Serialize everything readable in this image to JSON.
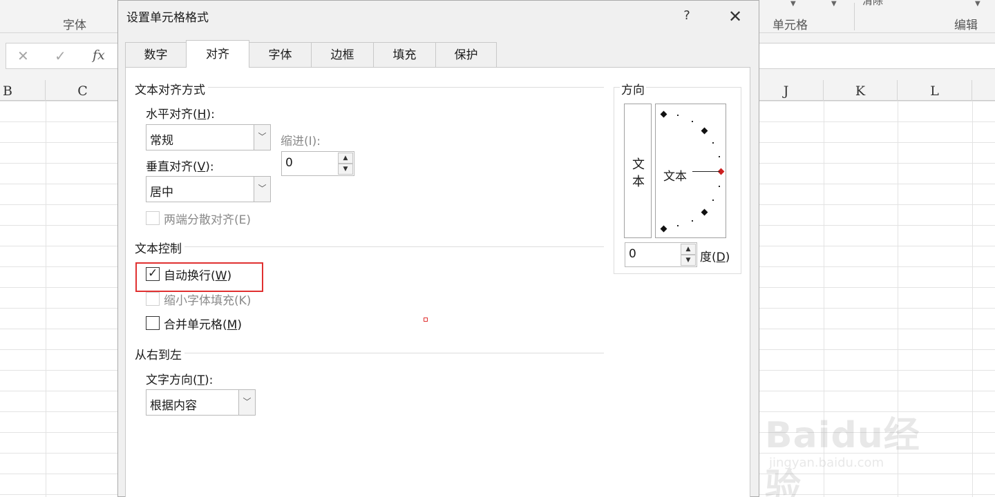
{
  "ribbon": {
    "groups": [
      "字体",
      "单元格",
      "编辑"
    ],
    "clear_partial": "清除"
  },
  "formula_bar": {
    "cancel_icon": "✕",
    "enter_icon": "✓",
    "fx_label": "fx"
  },
  "columns": [
    "B",
    "C",
    "J",
    "K",
    "L"
  ],
  "dialog": {
    "title": "设置单元格格式",
    "help": "?",
    "close": "✕",
    "tabs": [
      "数字",
      "对齐",
      "字体",
      "边框",
      "填充",
      "保护"
    ],
    "active_tab": "对齐",
    "text_alignment": {
      "title": "文本对齐方式",
      "horizontal_label": "水平对齐(H):",
      "horizontal_label_pre": "水平对齐(",
      "horizontal_label_key": "H",
      "horizontal_label_post": "):",
      "horizontal_value": "常规",
      "indent_label": "缩进(I):",
      "indent_value": "0",
      "vertical_label_pre": "垂直对齐(",
      "vertical_label_key": "V",
      "vertical_label_post": "):",
      "vertical_value": "居中",
      "justify_distributed": "两端分散对齐(E)"
    },
    "text_control": {
      "title": "文本控制",
      "wrap_text_pre": "自动换行(",
      "wrap_text_key": "W",
      "wrap_text_post": ")",
      "wrap_text_checked": true,
      "shrink_to_fit": "缩小字体填充(K)",
      "merge_cells_pre": "合并单元格(",
      "merge_cells_key": "M",
      "merge_cells_post": ")",
      "merge_cells_checked": false
    },
    "rtl": {
      "title": "从右到左",
      "direction_label_pre": "文字方向(",
      "direction_label_key": "T",
      "direction_label_post": "):",
      "direction_value": "根据内容"
    },
    "orientation": {
      "title": "方向",
      "vertical_text_1": "文",
      "vertical_text_2": "本",
      "dial_text": "文本",
      "degrees_value": "0",
      "degrees_label_pre": "度(",
      "degrees_label_key": "D",
      "degrees_label_post": ")"
    }
  },
  "watermark": {
    "brand": "Baidu经验",
    "url": "jingyan.baidu.com"
  },
  "colors": {
    "highlight": "#e03030",
    "dialog_bg": "#f0f0f0",
    "panel_bg": "#ffffff",
    "dial_marker": "#cc2020"
  }
}
